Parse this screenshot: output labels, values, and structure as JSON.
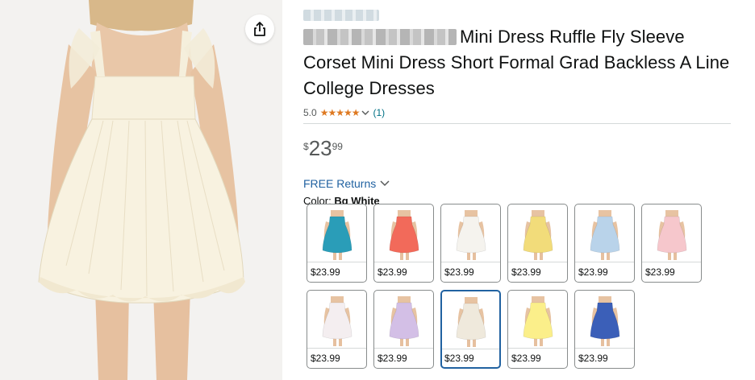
{
  "product": {
    "title_visible": "Mini Dress Ruffle Fly Sleeve Corset Mini Dress Short Formal Grad Backless A Line College Dresses",
    "rating": {
      "value": "5.0",
      "stars": "★★★★★",
      "count": "(1)"
    },
    "price": {
      "symbol": "$",
      "whole": "23",
      "fraction": "99"
    },
    "returns": "FREE Returns",
    "color": {
      "label": "Color:",
      "selected": "Bg White"
    },
    "swatches": [
      {
        "price": "$23.99",
        "color": "#2a9db8"
      },
      {
        "price": "$23.99",
        "color": "#f26a5a"
      },
      {
        "price": "$23.99",
        "color": "#f5f3ee"
      },
      {
        "price": "$23.99",
        "color": "#f2dc7a"
      },
      {
        "price": "$23.99",
        "color": "#b9d3ea"
      },
      {
        "price": "$23.99",
        "color": "#f6c7cc"
      },
      {
        "price": "$23.99",
        "color": "#f4eef0"
      },
      {
        "price": "$23.99",
        "color": "#d3bfe6"
      },
      {
        "price": "$23.99",
        "color": "#efe9dc"
      },
      {
        "price": "$23.99",
        "color": "#fbef8a"
      },
      {
        "price": "$23.99",
        "color": "#3b5fb8"
      }
    ]
  },
  "icons": {
    "share": "share-icon",
    "chevron": "chevron-down-icon"
  }
}
